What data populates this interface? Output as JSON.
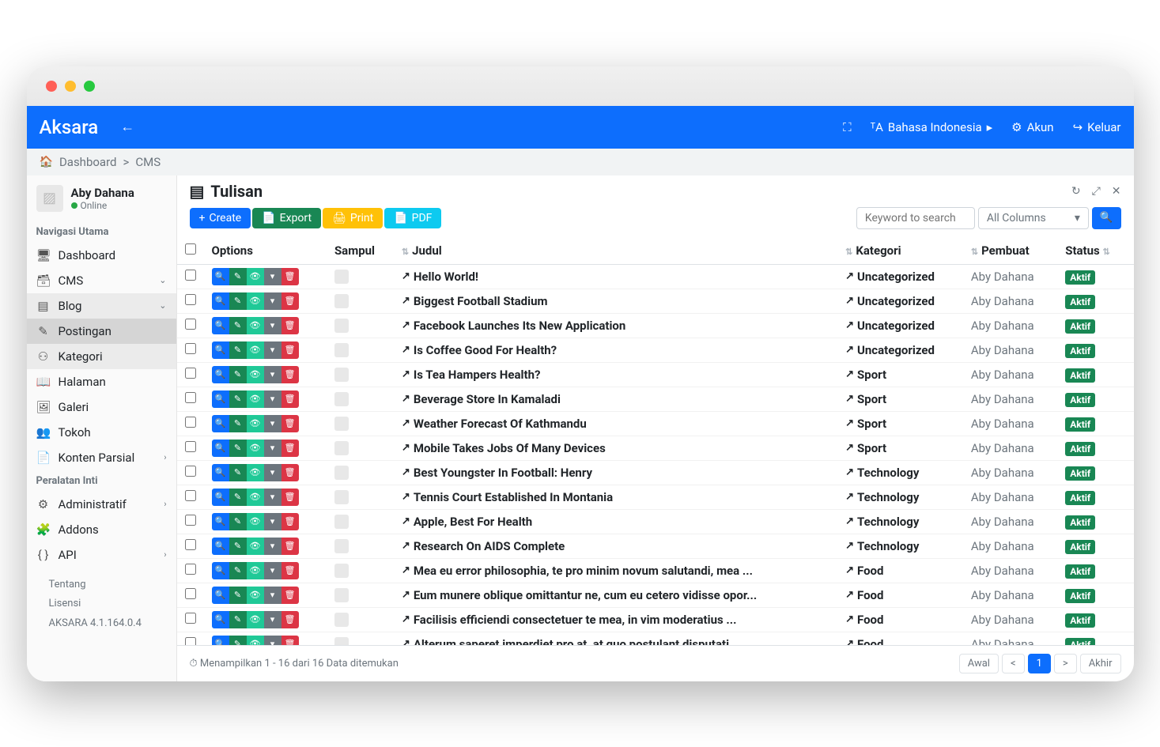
{
  "brand": "Aksara",
  "topbar": {
    "language": "Bahasa Indonesia",
    "account": "Akun",
    "logout": "Keluar"
  },
  "breadcrumb": {
    "home": "Dashboard",
    "current": "CMS"
  },
  "user": {
    "name": "Aby Dahana",
    "status": "Online"
  },
  "sidebar": {
    "heading1": "Navigasi Utama",
    "dashboard": "Dashboard",
    "cms": "CMS",
    "blog": "Blog",
    "postingan": "Postingan",
    "kategori": "Kategori",
    "halaman": "Halaman",
    "galeri": "Galeri",
    "tokoh": "Tokoh",
    "konten": "Konten Parsial",
    "heading2": "Peralatan Inti",
    "admin": "Administratif",
    "addons": "Addons",
    "api": "API",
    "about": "Tentang",
    "license": "Lisensi",
    "version": "AKSARA 4.1.164.0.4"
  },
  "page": {
    "title": "Tulisan",
    "create": "Create",
    "export": "Export",
    "print": "Print",
    "pdf": "PDF",
    "search_placeholder": "Keyword to search",
    "all_columns": "All Columns"
  },
  "columns": {
    "options": "Options",
    "sampul": "Sampul",
    "judul": "Judul",
    "kategori": "Kategori",
    "pembuat": "Pembuat",
    "status": "Status"
  },
  "rows": [
    {
      "judul": "Hello World!",
      "kategori": "Uncategorized",
      "pembuat": "Aby Dahana",
      "status": "Aktif"
    },
    {
      "judul": "Biggest Football Stadium",
      "kategori": "Uncategorized",
      "pembuat": "Aby Dahana",
      "status": "Aktif"
    },
    {
      "judul": "Facebook Launches Its New Application",
      "kategori": "Uncategorized",
      "pembuat": "Aby Dahana",
      "status": "Aktif"
    },
    {
      "judul": "Is Coffee Good For Health?",
      "kategori": "Uncategorized",
      "pembuat": "Aby Dahana",
      "status": "Aktif"
    },
    {
      "judul": "Is Tea Hampers Health?",
      "kategori": "Sport",
      "pembuat": "Aby Dahana",
      "status": "Aktif"
    },
    {
      "judul": "Beverage Store In Kamaladi",
      "kategori": "Sport",
      "pembuat": "Aby Dahana",
      "status": "Aktif"
    },
    {
      "judul": "Weather Forecast Of Kathmandu",
      "kategori": "Sport",
      "pembuat": "Aby Dahana",
      "status": "Aktif"
    },
    {
      "judul": "Mobile Takes Jobs Of Many Devices",
      "kategori": "Sport",
      "pembuat": "Aby Dahana",
      "status": "Aktif"
    },
    {
      "judul": "Best Youngster In Football: Henry",
      "kategori": "Technology",
      "pembuat": "Aby Dahana",
      "status": "Aktif"
    },
    {
      "judul": "Tennis Court Established In Montania",
      "kategori": "Technology",
      "pembuat": "Aby Dahana",
      "status": "Aktif"
    },
    {
      "judul": "Apple, Best For Health",
      "kategori": "Technology",
      "pembuat": "Aby Dahana",
      "status": "Aktif"
    },
    {
      "judul": "Research On AIDS Complete",
      "kategori": "Technology",
      "pembuat": "Aby Dahana",
      "status": "Aktif"
    },
    {
      "judul": "Mea eu error philosophia, te pro minim novum salutandi, mea ...",
      "kategori": "Food",
      "pembuat": "Aby Dahana",
      "status": "Aktif"
    },
    {
      "judul": "Eum munere oblique omittantur ne, cum eu cetero vidisse opor...",
      "kategori": "Food",
      "pembuat": "Aby Dahana",
      "status": "Aktif"
    },
    {
      "judul": "Facilisis efficiendi consectetuer te mea, in vim moderatius ...",
      "kategori": "Food",
      "pembuat": "Aby Dahana",
      "status": "Aktif"
    },
    {
      "judul": "Alterum saperet imperdiet pro at, at quo postulant disputati...",
      "kategori": "Food",
      "pembuat": "Aby Dahana",
      "status": "Aktif"
    }
  ],
  "footer": {
    "info": "Menampilkan 1 - 16 dari 16 Data ditemukan",
    "first": "Awal",
    "prev": "<",
    "page": "1",
    "next": ">",
    "last": "Akhir"
  }
}
